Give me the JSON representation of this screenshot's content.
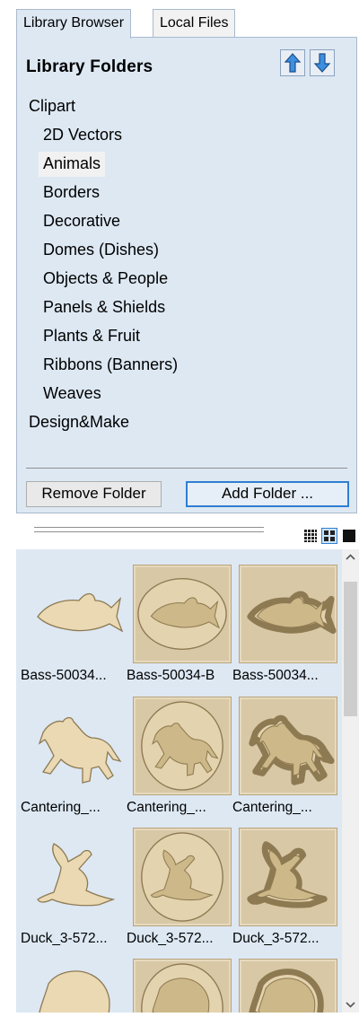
{
  "tabs": [
    {
      "label": "Library Browser",
      "active": true
    },
    {
      "label": "Local Files",
      "active": false
    }
  ],
  "panel": {
    "title": "Library Folders",
    "move_up_icon": "arrow-up-icon",
    "move_down_icon": "arrow-down-icon"
  },
  "tree": [
    {
      "label": "Clipart",
      "level": 0
    },
    {
      "label": "2D Vectors",
      "level": 1
    },
    {
      "label": "Animals",
      "level": 1,
      "selected": true
    },
    {
      "label": "Borders",
      "level": 1
    },
    {
      "label": "Decorative",
      "level": 1
    },
    {
      "label": "Domes (Dishes)",
      "level": 1
    },
    {
      "label": "Objects & People",
      "level": 1
    },
    {
      "label": "Panels & Shields",
      "level": 1
    },
    {
      "label": "Plants & Fruit",
      "level": 1
    },
    {
      "label": "Ribbons (Banners)",
      "level": 1
    },
    {
      "label": "Weaves",
      "level": 1
    },
    {
      "label": "Design&Make",
      "level": 0
    }
  ],
  "buttons": {
    "remove_folder": "Remove Folder",
    "add_folder": "Add Folder ..."
  },
  "view_toggles": [
    "small-thumbnails-icon",
    "large-thumbnails-icon",
    "single-view-icon"
  ],
  "thumbnails": [
    {
      "label": "Bass-50034...",
      "subject": "fish",
      "style": "plain"
    },
    {
      "label": "Bass-50034-B",
      "subject": "fish",
      "style": "oval"
    },
    {
      "label": "Bass-50034...",
      "subject": "fish",
      "style": "contour"
    },
    {
      "label": "Cantering_...",
      "subject": "horse",
      "style": "plain"
    },
    {
      "label": "Cantering_...",
      "subject": "horse",
      "style": "oval"
    },
    {
      "label": "Cantering_...",
      "subject": "horse",
      "style": "contour"
    },
    {
      "label": "Duck_3-572...",
      "subject": "duck",
      "style": "plain"
    },
    {
      "label": "Duck_3-572...",
      "subject": "duck",
      "style": "oval"
    },
    {
      "label": "Duck_3-572...",
      "subject": "duck",
      "style": "contour"
    },
    {
      "label": "",
      "subject": "eagle",
      "style": "plain"
    },
    {
      "label": "",
      "subject": "eagle",
      "style": "oval"
    },
    {
      "label": "",
      "subject": "eagle",
      "style": "contour"
    }
  ],
  "colors": {
    "panel_bg": "#dde8f3",
    "relief": "#d8c8a6",
    "accent": "#2f7fd1"
  }
}
